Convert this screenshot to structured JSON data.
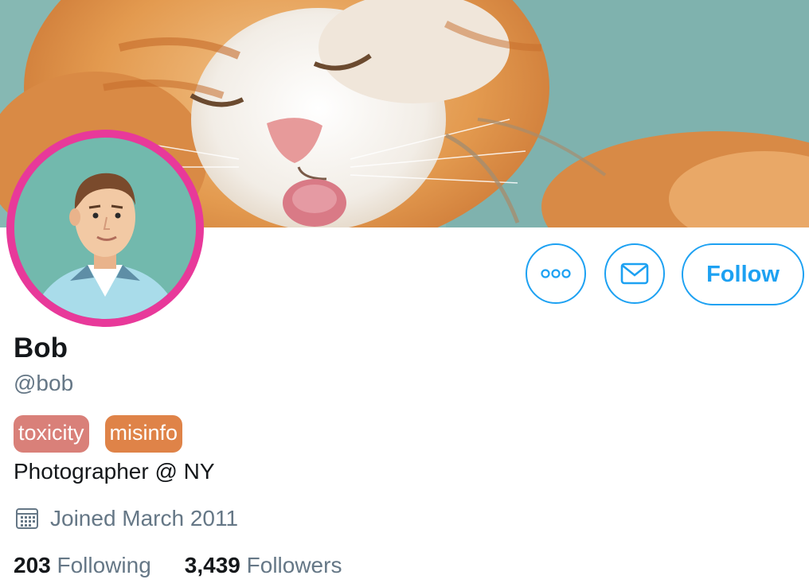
{
  "profile": {
    "name": "Bob",
    "handle": "@bob",
    "bio": "Photographer @ NY",
    "joined": "Joined March 2011"
  },
  "tags": [
    {
      "label": "toxicity",
      "color": "#d98079"
    },
    {
      "label": "misinfo",
      "color": "#df8348"
    }
  ],
  "actions": {
    "more_icon": "more-horizontal-icon",
    "message_icon": "envelope-icon",
    "follow_label": "Follow"
  },
  "stats": {
    "following_count": "203",
    "following_label": "Following",
    "followers_count": "3,439",
    "followers_label": "Followers"
  },
  "colors": {
    "accent": "#1da1f2",
    "avatar_ring": "#e8399a",
    "muted_text": "#657786"
  },
  "icons": {
    "calendar": "calendar-icon",
    "banner": "cat-banner-image",
    "avatar": "man-avatar-illustration"
  }
}
